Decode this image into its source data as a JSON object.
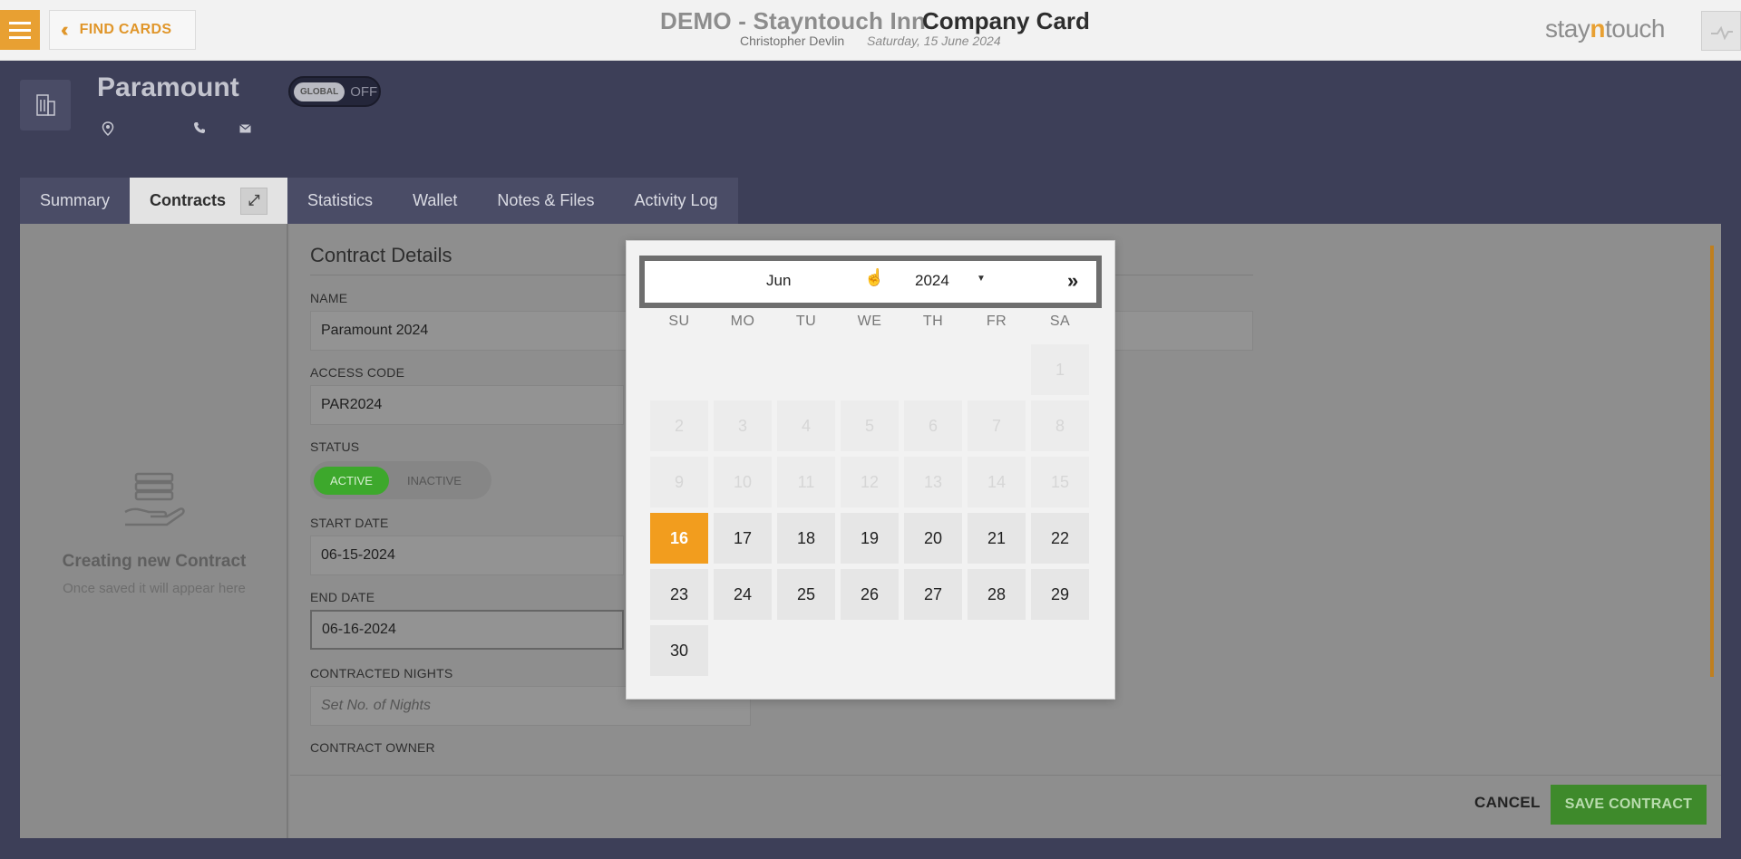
{
  "header": {
    "find_cards_label": "FIND CARDS",
    "hotel_title": "DEMO - Stayntouch Inn",
    "card_title": "Company Card",
    "user_name": "Christopher Devlin",
    "date": "Saturday, 15 June 2024",
    "logo_prefix": "stay",
    "logo_accent": "n",
    "logo_suffix": "touch"
  },
  "company": {
    "name": "Paramount",
    "global_label": "GLOBAL",
    "global_state": "OFF"
  },
  "tabs": [
    {
      "label": "Summary"
    },
    {
      "label": "Contracts"
    },
    {
      "label": "Statistics"
    },
    {
      "label": "Wallet"
    },
    {
      "label": "Notes & Files"
    },
    {
      "label": "Activity Log"
    }
  ],
  "sidebar": {
    "empty_title": "Creating new Contract",
    "empty_subtitle": "Once saved it will appear here"
  },
  "form": {
    "section_title": "Contract Details",
    "name_label": "NAME",
    "name_value": "Paramount 2024",
    "access_code_label": "ACCESS CODE",
    "access_code_value": "PAR2024",
    "status_label": "STATUS",
    "status_active": "ACTIVE",
    "status_inactive": "INACTIVE",
    "start_date_label": "START DATE",
    "start_date_value": "06-15-2024",
    "end_date_label": "END DATE",
    "end_date_value": "06-16-2024",
    "nights_label": "CONTRACTED NIGHTS",
    "nights_placeholder": "Set No. of Nights",
    "owner_label": "CONTRACT OWNER"
  },
  "footer": {
    "cancel_label": "CANCEL",
    "save_label": "SAVE CONTRACT"
  },
  "datepicker": {
    "month": "Jun",
    "year": "2024",
    "next_label": "»",
    "weekdays": [
      "SU",
      "MO",
      "TU",
      "WE",
      "TH",
      "FR",
      "SA"
    ],
    "selected_day": "16",
    "days": [
      "1",
      "2",
      "3",
      "4",
      "5",
      "6",
      "7",
      "8",
      "9",
      "10",
      "11",
      "12",
      "13",
      "14",
      "15",
      "16",
      "17",
      "18",
      "19",
      "20",
      "21",
      "22",
      "23",
      "24",
      "25",
      "26",
      "27",
      "28",
      "29",
      "30"
    ]
  },
  "colors": {
    "accent": "#e8a032",
    "selected": "#f29d1e",
    "active_green": "#3da82c"
  }
}
